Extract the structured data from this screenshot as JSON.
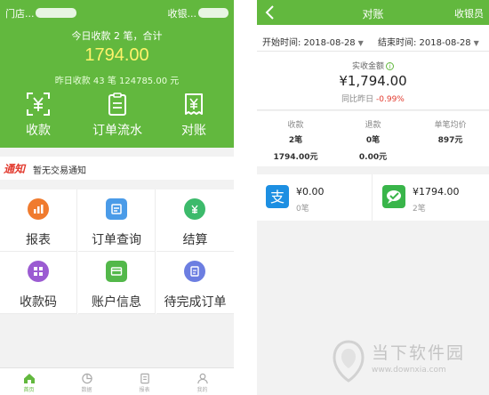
{
  "left": {
    "store_label": "门店...",
    "cashier_label": "收银...",
    "today_summary": "今日收款 2 笔，合计",
    "today_amount": "1794.00",
    "yesterday_summary": "昨日收款 43 笔 124785.00 元",
    "actions": [
      {
        "label": "收款",
        "icon": "scan-yen-icon"
      },
      {
        "label": "订单流水",
        "icon": "clipboard-icon"
      },
      {
        "label": "对账",
        "icon": "receipt-icon"
      }
    ],
    "notice": {
      "tag": "通知",
      "text": "暂无交易通知"
    },
    "grid": [
      {
        "label": "报表",
        "icon": "report-chart-icon",
        "color": "#f07b2e"
      },
      {
        "label": "订单查询",
        "icon": "order-search-icon",
        "color": "#4a9be8"
      },
      {
        "label": "结算",
        "icon": "settlement-icon",
        "color": "#3cba6b"
      },
      {
        "label": "收款码",
        "icon": "qr-code-icon",
        "color": "#9b5bd2"
      },
      {
        "label": "账户信息",
        "icon": "account-card-icon",
        "color": "#53b84a"
      },
      {
        "label": "待完成订单",
        "icon": "pending-order-icon",
        "color": "#6c7ee1"
      }
    ],
    "tabs": [
      {
        "label": "首页",
        "icon": "home-icon",
        "active": true
      },
      {
        "label": "数据",
        "icon": "chart-pie-icon",
        "active": false
      },
      {
        "label": "报表",
        "icon": "document-icon",
        "active": false
      },
      {
        "label": "我的",
        "icon": "user-icon",
        "active": false
      }
    ]
  },
  "right": {
    "title": "对账",
    "cashier": "收银员",
    "start_date": "开始时间: 2018-08-28",
    "end_date": "结束时间: 2018-08-28",
    "received_caption": "实收金额",
    "received_amount": "¥1,794.00",
    "compare_label": "同比昨日",
    "compare_value": "-0.99%",
    "stats": [
      {
        "head": "收款",
        "count": "2笔",
        "amount": "1794.00元"
      },
      {
        "head": "退款",
        "count": "0笔",
        "amount": "0.00元"
      },
      {
        "head": "单笔均价",
        "count": "897元",
        "amount": ""
      }
    ],
    "payments": [
      {
        "icon": "alipay-icon",
        "amount": "¥0.00",
        "count": "0笔",
        "color": "#1d8fe2"
      },
      {
        "icon": "wechat-pay-icon",
        "amount": "¥1794.00",
        "count": "2笔",
        "color": "#39b54a"
      }
    ]
  },
  "watermark": {
    "text": "当下软件园",
    "url": "www.downxia.com"
  },
  "colors": {
    "brand_green": "#62b83e",
    "amount_yellow": "#fff36b",
    "negative_red": "#e23a2e"
  }
}
